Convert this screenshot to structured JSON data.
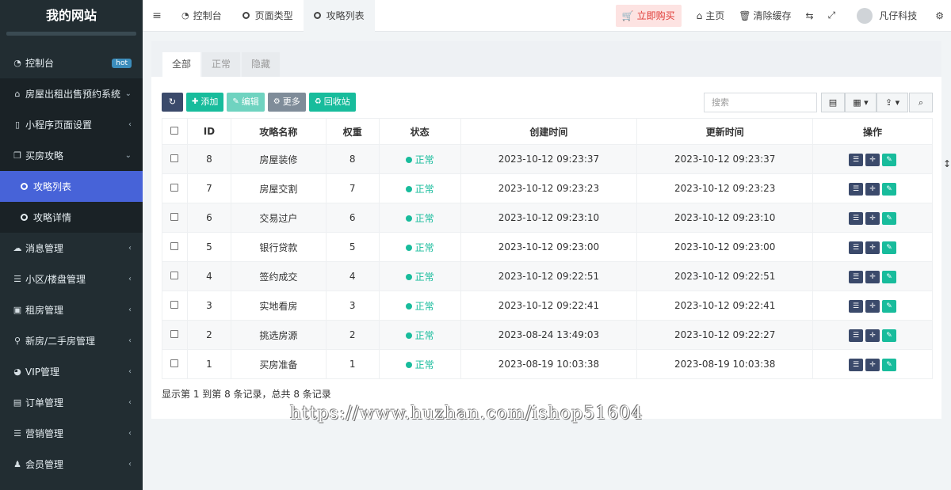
{
  "sidebar": {
    "brand": "我的网站",
    "items": [
      {
        "label": "控制台",
        "icon": "dashboard-icon",
        "badge": "hot"
      },
      {
        "label": "房屋出租出售预约系统",
        "icon": "home-icon"
      },
      {
        "label": "小程序页面设置",
        "icon": "bookmark-icon"
      },
      {
        "label": "买房攻略",
        "icon": "copy-icon"
      },
      {
        "label": "攻略列表",
        "icon": "circle-icon"
      },
      {
        "label": "攻略详情",
        "icon": "circle-icon"
      },
      {
        "label": "消息管理",
        "icon": "comment-icon"
      },
      {
        "label": "小区/楼盘管理",
        "icon": "list-icon"
      },
      {
        "label": "租房管理",
        "icon": "building-icon"
      },
      {
        "label": "新房/二手房管理",
        "icon": "map-marker-icon"
      },
      {
        "label": "VIP管理",
        "icon": "gauge-icon"
      },
      {
        "label": "订单管理",
        "icon": "file-icon"
      },
      {
        "label": "营销管理",
        "icon": "list-icon"
      },
      {
        "label": "会员管理",
        "icon": "user-icon"
      }
    ]
  },
  "topbar": {
    "tabs": [
      "控制台",
      "页面类型",
      "攻略列表"
    ],
    "buy": "立即购买",
    "home": "主页",
    "clear_cache": "清除缓存",
    "user": "凡仔科技"
  },
  "panel": {
    "tabs": [
      "全部",
      "正常",
      "隐藏"
    ],
    "buttons": {
      "add": "添加",
      "edit": "编辑",
      "more": "更多",
      "recycle": "回收站"
    },
    "search_placeholder": "搜索",
    "columns": [
      "ID",
      "攻略名称",
      "权重",
      "状态",
      "创建时间",
      "更新时间",
      "操作"
    ],
    "rows": [
      {
        "id": "8",
        "name": "房屋装修",
        "weight": "8",
        "status": "正常",
        "created": "2023-10-12 09:23:37",
        "updated": "2023-10-12 09:23:37"
      },
      {
        "id": "7",
        "name": "房屋交割",
        "weight": "7",
        "status": "正常",
        "created": "2023-10-12 09:23:23",
        "updated": "2023-10-12 09:23:23"
      },
      {
        "id": "6",
        "name": "交易过户",
        "weight": "6",
        "status": "正常",
        "created": "2023-10-12 09:23:10",
        "updated": "2023-10-12 09:23:10"
      },
      {
        "id": "5",
        "name": "银行贷款",
        "weight": "5",
        "status": "正常",
        "created": "2023-10-12 09:23:00",
        "updated": "2023-10-12 09:23:00"
      },
      {
        "id": "4",
        "name": "签约成交",
        "weight": "4",
        "status": "正常",
        "created": "2023-10-12 09:22:51",
        "updated": "2023-10-12 09:22:51"
      },
      {
        "id": "3",
        "name": "实地看房",
        "weight": "3",
        "status": "正常",
        "created": "2023-10-12 09:22:41",
        "updated": "2023-10-12 09:22:41"
      },
      {
        "id": "2",
        "name": "挑选房源",
        "weight": "2",
        "status": "正常",
        "created": "2023-08-24 13:49:03",
        "updated": "2023-10-12 09:22:27"
      },
      {
        "id": "1",
        "name": "买房准备",
        "weight": "1",
        "status": "正常",
        "created": "2023-08-19 10:03:38",
        "updated": "2023-08-19 10:03:38"
      }
    ],
    "summary": "显示第 1 到第 8 条记录，总共 8 条记录"
  },
  "watermark": "https://www.huzhan.com/ishop51604",
  "colors": {
    "sidebar": "#222d32",
    "active": "#4763d8",
    "success": "#18bc9c",
    "danger": "#e03b36"
  }
}
